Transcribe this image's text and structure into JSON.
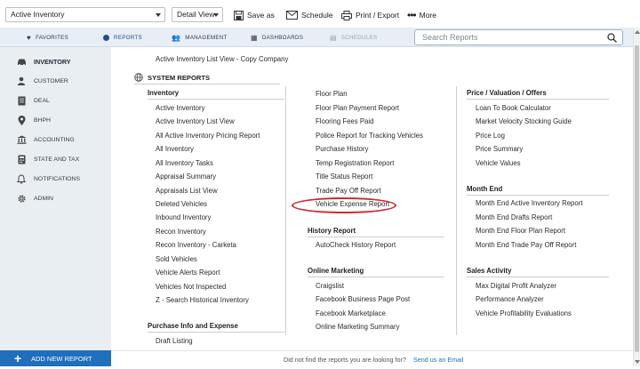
{
  "toolbar": {
    "report_select": "Active Inventory",
    "view_select": "Detail View",
    "save_as": "Save as",
    "schedule": "Schedule",
    "print_export": "Print / Export",
    "more": "More"
  },
  "nav": {
    "tabs": [
      "FAVORITES",
      "REPORTS",
      "MANAGEMENT",
      "DASHBOARDS",
      "SCHEDULES"
    ],
    "active_tab": "REPORTS",
    "search_placeholder": "Search Reports"
  },
  "sidebar": {
    "items": [
      "INVENTORY",
      "CUSTOMER",
      "DEAL",
      "BHPH",
      "ACCOUNTING",
      "STATE AND TAX",
      "NOTIFICATIONS",
      "ADMIN"
    ],
    "active": "INVENTORY",
    "add_button": "ADD NEW REPORT"
  },
  "main": {
    "custom_report": "Active Inventory List View - Copy Company",
    "system_reports_title": "SYSTEM REPORTS",
    "col1": {
      "inventory_title": "Inventory",
      "inventory": [
        "Active Inventory",
        "Active Inventory List View",
        "All Active Inventory Pricing Report",
        "All Inventory",
        "All Inventory Tasks",
        "Appraisal Summary",
        "Appraisals List View",
        "Deleted Vehicles",
        "Inbound Inventory",
        "Recon Inventory",
        "Recon Inventory - Carketa",
        "Sold Vehicles",
        "Vehicle Alerts Report",
        "Vehicles Not Inspected",
        "Z - Search Historical Inventory"
      ],
      "purchase_title": "Purchase Info and Expense",
      "purchase": [
        "Draft Listing"
      ]
    },
    "col2": {
      "misc": [
        "Floor Plan",
        "Floor Plan Payment Report",
        "Flooring Fees Paid",
        "Police Report for Tracking Vehicles",
        "Purchase History",
        "Temp Registration Report",
        "Title Status Report",
        "Trade Pay Off Report",
        "Vehicle Expense Report"
      ],
      "history_title": "History Report",
      "history": [
        "AutoCheck History Report"
      ],
      "marketing_title": "Online Marketing",
      "marketing": [
        "Craigslist",
        "Facebook Business Page Post",
        "Facebook Marketplace",
        "Online Marketing Summary"
      ]
    },
    "col3": {
      "price_title": "Price / Valuation / Offers",
      "price": [
        "Loan To Book Calculator",
        "Market Velocity Stocking Guide",
        "Price Log",
        "Price Summary",
        "Vehicle Values"
      ],
      "month_title": "Month End",
      "month": [
        "Month End Active Inventory Report",
        "Month End Drafts Report",
        "Month End Floor Plan Report",
        "Month End Trade Pay Off Report"
      ],
      "sales_title": "Sales Activity",
      "sales": [
        "Max Digital Profit Analyzer",
        "Performance Analyzer",
        "Vehicle Profitability Evaluations"
      ]
    }
  },
  "footer": {
    "message": "Did not find the reports you are looking for?",
    "link": "Send us an Email"
  },
  "colors": {
    "accent": "#1f6fbd",
    "nav_bg": "#e7eef5",
    "sidebar_bg": "#e9eef3",
    "highlight": "#cc2b2b"
  }
}
